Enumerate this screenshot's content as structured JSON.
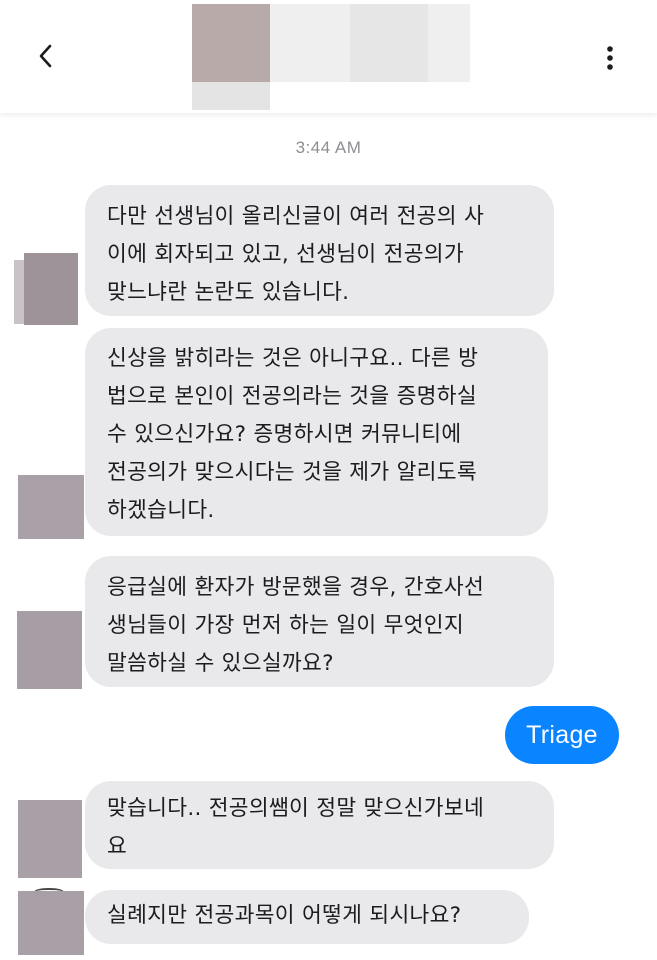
{
  "header": {
    "back_icon": "chevron-left-icon",
    "more_icon": "vertical-ellipsis-icon",
    "contact_name_redacted": true
  },
  "timestamp": "3:44 AM",
  "messages": [
    {
      "direction": "incoming",
      "lines": [
        "다만 선생님이 올리신글이 여러 전공의 사",
        "이에 회자되고 있고, 선생님이 전공의가",
        "맞느냐란 논란도 있습니다."
      ]
    },
    {
      "direction": "incoming",
      "lines": [
        "신상을 밝히라는 것은 아니구요.. 다른 방",
        "법으로 본인이 전공의라는 것을 증명하실",
        "수 있으신가요? 증명하시면 커뮤니티에",
        "전공의가 맞으시다는 것을 제가 알리도록",
        "하겠습니다."
      ]
    },
    {
      "direction": "incoming",
      "lines": [
        "응급실에 환자가 방문했을 경우, 간호사선",
        "생님들이 가장 먼저 하는 일이 무엇인지",
        "말씀하실 수 있으실까요?"
      ]
    },
    {
      "direction": "outgoing",
      "text": "Triage"
    },
    {
      "direction": "incoming",
      "lines": [
        "맞습니다.. 전공의쌤이 정말 맞으신가보네",
        "요"
      ]
    },
    {
      "direction": "incoming",
      "lines": [
        "실례지만 전공과목이 어떻게 되시나요?"
      ]
    }
  ],
  "colors": {
    "incoming_bubble": "#e9e9eb",
    "outgoing_bubble": "#0a84ff",
    "timestamp_text": "#8e8e93"
  }
}
